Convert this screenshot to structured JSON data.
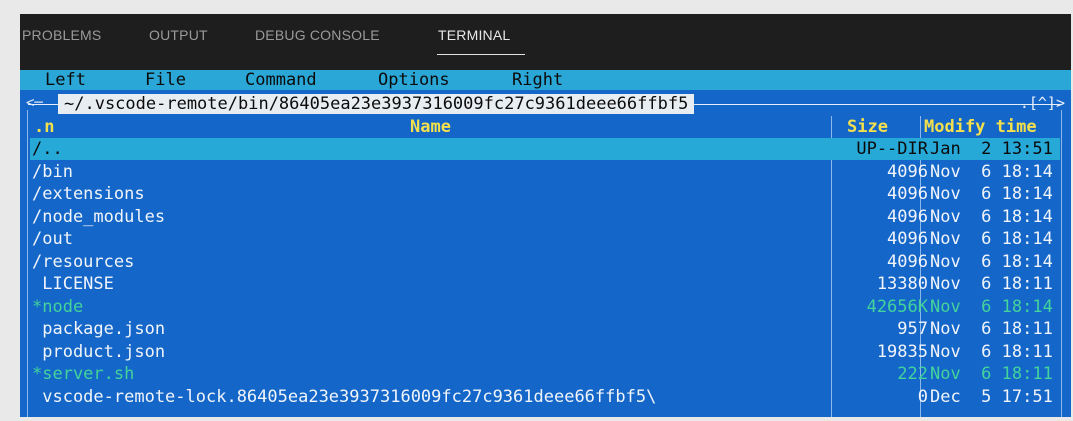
{
  "panel_tabs": [
    "PROBLEMS",
    "OUTPUT",
    "DEBUG CONSOLE",
    "TERMINAL"
  ],
  "active_tab": "TERMINAL",
  "mc": {
    "menu": [
      "Left",
      "File",
      "Command",
      "Options",
      "Right"
    ],
    "path": "~/.vscode-remote/bin/86405ea23e3937316009fc27c9361deee66ffbf5",
    "path_right": ".[^]>",
    "headers": {
      "sort": ".n",
      "name": "Name",
      "size": "Size",
      "modify": "Modify time"
    },
    "rows": [
      {
        "name": "/..",
        "size": "UP--DIR",
        "modified": "Jan  2 13:51",
        "selected": true,
        "exec": false
      },
      {
        "name": "/bin",
        "size": "4096",
        "modified": "Nov  6 18:14",
        "selected": false,
        "exec": false
      },
      {
        "name": "/extensions",
        "size": "4096",
        "modified": "Nov  6 18:14",
        "selected": false,
        "exec": false
      },
      {
        "name": "/node_modules",
        "size": "4096",
        "modified": "Nov  6 18:14",
        "selected": false,
        "exec": false
      },
      {
        "name": "/out",
        "size": "4096",
        "modified": "Nov  6 18:14",
        "selected": false,
        "exec": false
      },
      {
        "name": "/resources",
        "size": "4096",
        "modified": "Nov  6 18:14",
        "selected": false,
        "exec": false
      },
      {
        "name": " LICENSE",
        "size": "13380",
        "modified": "Nov  6 18:11",
        "selected": false,
        "exec": false
      },
      {
        "name": "*node",
        "size": "42656K",
        "modified": "Nov  6 18:14",
        "selected": false,
        "exec": true
      },
      {
        "name": " package.json",
        "size": "957",
        "modified": "Nov  6 18:11",
        "selected": false,
        "exec": false
      },
      {
        "name": " product.json",
        "size": "19835",
        "modified": "Nov  6 18:11",
        "selected": false,
        "exec": false
      },
      {
        "name": "*server.sh",
        "size": "222",
        "modified": "Nov  6 18:11",
        "selected": false,
        "exec": true
      },
      {
        "name": " vscode-remote-lock.86405ea23e3937316009fc27c9361deee66ffbf5\\",
        "size": "0",
        "modified": "Dec  5 17:51",
        "selected": false,
        "exec": false
      }
    ]
  },
  "colors": {
    "terminal_bg": "#1467c8",
    "menubar_bg": "#2aa7d6",
    "header_text": "#f4e04d",
    "exec_text": "#43d39b"
  }
}
